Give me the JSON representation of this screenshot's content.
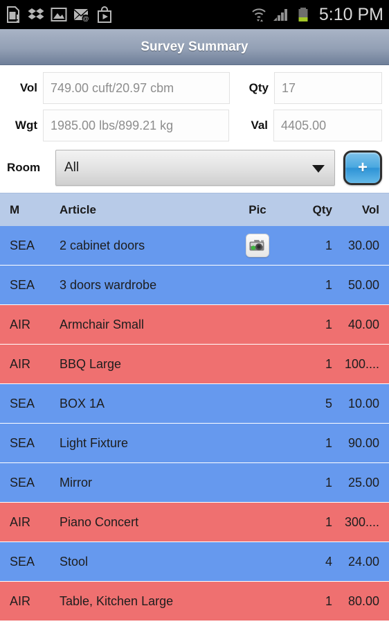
{
  "statusbar": {
    "time": "5:10 PM",
    "left_icons": [
      "sim-card-icon",
      "dropbox-icon",
      "gallery-icon",
      "email-icon",
      "play-store-icon"
    ],
    "right_icons": [
      "wifi-icon",
      "signal-icon",
      "battery-icon"
    ]
  },
  "titlebar": {
    "title": "Survey Summary"
  },
  "summary": {
    "vol_label": "Vol",
    "vol_value": "749.00 cuft/20.97 cbm",
    "qty_label": "Qty",
    "qty_value": "17",
    "wgt_label": "Wgt",
    "wgt_value": "1985.00 lbs/899.21 kg",
    "val_label": "Val",
    "val_value": "4405.00"
  },
  "room": {
    "label": "Room",
    "selected": "All",
    "add_button_label": "+"
  },
  "table": {
    "headers": {
      "m": "M",
      "article": "Article",
      "pic": "Pic",
      "qty": "Qty",
      "vol": "Vol"
    },
    "rows": [
      {
        "mode": "SEA",
        "article": "2 cabinet doors",
        "pic": "camera-icon",
        "qty": "1",
        "vol": "30.00"
      },
      {
        "mode": "SEA",
        "article": "3 doors wardrobe",
        "pic": "",
        "qty": "1",
        "vol": "50.00"
      },
      {
        "mode": "AIR",
        "article": "Armchair Small",
        "pic": "",
        "qty": "1",
        "vol": "40.00"
      },
      {
        "mode": "AIR",
        "article": "BBQ Large",
        "pic": "",
        "qty": "1",
        "vol": "100...."
      },
      {
        "mode": "SEA",
        "article": "BOX 1A",
        "pic": "",
        "qty": "5",
        "vol": "10.00"
      },
      {
        "mode": "SEA",
        "article": "Light Fixture",
        "pic": "",
        "qty": "1",
        "vol": "90.00"
      },
      {
        "mode": "SEA",
        "article": "Mirror",
        "pic": "",
        "qty": "1",
        "vol": "25.00"
      },
      {
        "mode": "AIR",
        "article": "Piano Concert",
        "pic": "",
        "qty": "1",
        "vol": "300...."
      },
      {
        "mode": "SEA",
        "article": "Stool",
        "pic": "",
        "qty": "4",
        "vol": "24.00"
      },
      {
        "mode": "AIR",
        "article": "Table, Kitchen Large",
        "pic": "",
        "qty": "1",
        "vol": "80.00"
      }
    ]
  },
  "colors": {
    "sea_row": "#6699ee",
    "air_row": "#ef7070",
    "header_bar": "#b8cbe8",
    "title_bar": "#93a0b5",
    "accent_blue": "#4aa8e0"
  }
}
